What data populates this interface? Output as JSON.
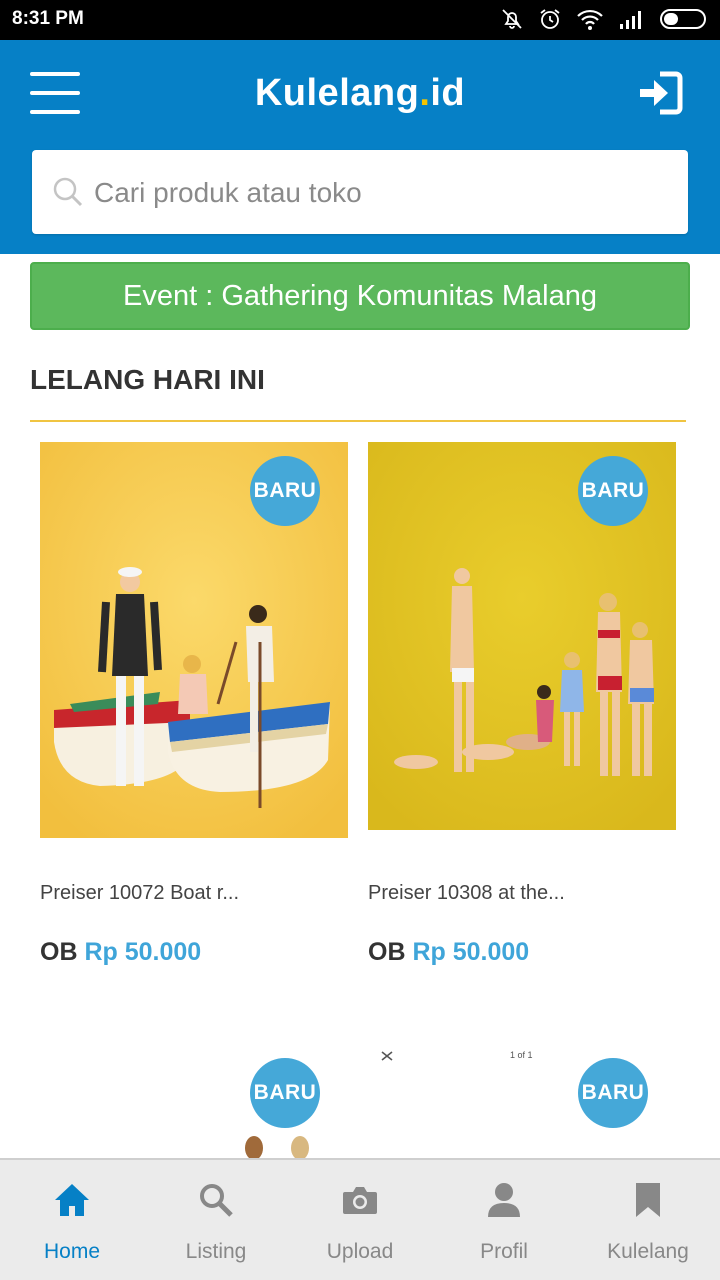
{
  "status_bar": {
    "time": "8:31 PM"
  },
  "header": {
    "logo_main": "Kulelang",
    "logo_dot": ".",
    "logo_suffix": "id"
  },
  "search": {
    "placeholder": "Cari produk atau toko"
  },
  "event_banner": {
    "label": "Event : Gathering Komunitas Malang"
  },
  "section": {
    "title": "LELANG HARI INI"
  },
  "products": [
    {
      "badge": "BARU",
      "name": "Preiser 10072 Boat r...",
      "price_prefix": "OB",
      "price": "Rp 50.000"
    },
    {
      "badge": "BARU",
      "name": "Preiser 10308 at the...",
      "price_prefix": "OB",
      "price": "Rp 50.000"
    },
    {
      "badge": "BARU"
    },
    {
      "badge": "BARU",
      "image_text": "1 of 1"
    }
  ],
  "bottom_nav": [
    {
      "label": "Home",
      "icon": "home-icon",
      "active": true
    },
    {
      "label": "Listing",
      "icon": "search-icon",
      "active": false
    },
    {
      "label": "Upload",
      "icon": "camera-icon",
      "active": false
    },
    {
      "label": "Profil",
      "icon": "user-icon",
      "active": false
    },
    {
      "label": "Kulelang",
      "icon": "bookmark-icon",
      "active": false
    }
  ],
  "colors": {
    "header_blue": "#0680c6",
    "event_green": "#5cb85c",
    "badge_blue": "#45a8d8",
    "price_blue": "#3fa5d9",
    "section_rule_yellow": "#f0c441"
  }
}
